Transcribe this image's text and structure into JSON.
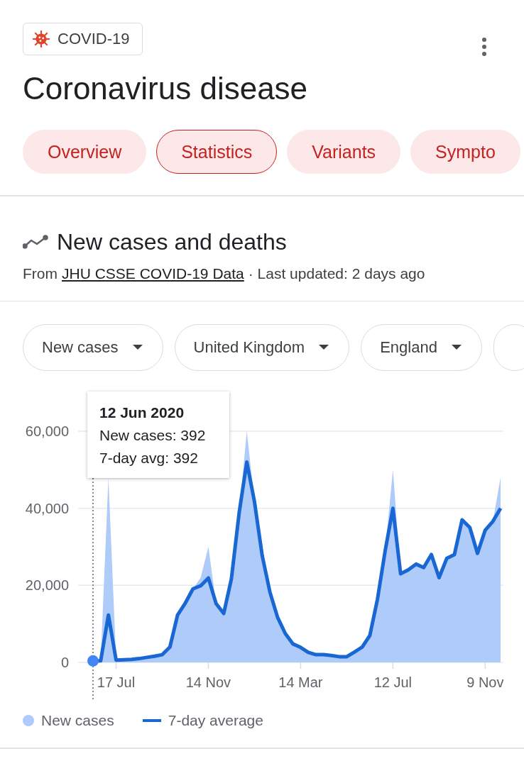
{
  "topic_chip": {
    "label": "COVID-19"
  },
  "title": "Coronavirus disease",
  "tabs": [
    {
      "label": "Overview",
      "selected": false
    },
    {
      "label": "Statistics",
      "selected": true
    },
    {
      "label": "Variants",
      "selected": false
    },
    {
      "label": "Sympto",
      "selected": false
    }
  ],
  "section": {
    "title": "New cases and deaths",
    "source_prefix": "From",
    "source_link": "JHU CSSE COVID-19 Data",
    "updated": "· Last updated: 2 days ago"
  },
  "filters": [
    {
      "label": "New cases"
    },
    {
      "label": "United Kingdom"
    },
    {
      "label": "England"
    }
  ],
  "chart": {
    "tooltip": {
      "date": "12 Jun 2020",
      "lines": [
        "New cases: 392",
        "7-day avg: 392"
      ]
    },
    "chart_data": {
      "type": "area",
      "categories": [
        null,
        null,
        null,
        "17 Jul",
        null,
        null,
        null,
        null,
        null,
        null,
        null,
        null,
        null,
        null,
        null,
        "14 Nov",
        null,
        null,
        null,
        null,
        null,
        null,
        null,
        null,
        null,
        null,
        null,
        "14 Mar",
        null,
        null,
        null,
        null,
        null,
        null,
        null,
        null,
        null,
        null,
        null,
        "12 Jul",
        null,
        null,
        null,
        null,
        null,
        null,
        null,
        null,
        null,
        null,
        null,
        "9 Nov",
        null,
        null
      ],
      "series": [
        {
          "name": "New cases",
          "type": "area",
          "color": "#aecbfa",
          "values": [
            400,
            400,
            48000,
            600,
            700,
            800,
            1000,
            1300,
            1600,
            2000,
            4000,
            12300,
            15400,
            19100,
            22000,
            30000,
            15300,
            12700,
            21700,
            38800,
            60000,
            41700,
            27700,
            18300,
            11700,
            7500,
            4800,
            3900,
            2600,
            2000,
            2000,
            1800,
            1500,
            1500,
            2700,
            4000,
            7000,
            16500,
            29000,
            50000,
            23000,
            24000,
            25500,
            24600,
            28000,
            22000,
            27000,
            28000,
            37000,
            35000,
            28300,
            34300,
            36600,
            48000
          ]
        },
        {
          "name": "7-day average",
          "type": "line",
          "color": "#1967d2",
          "values": [
            400,
            400,
            12300,
            600,
            700,
            800,
            1000,
            1300,
            1600,
            2000,
            4000,
            12300,
            15400,
            19100,
            19900,
            21900,
            15300,
            12700,
            21700,
            38800,
            52000,
            41700,
            27700,
            18300,
            11700,
            7500,
            4800,
            3900,
            2600,
            2000,
            2000,
            1800,
            1500,
            1500,
            2700,
            4000,
            7000,
            16500,
            29000,
            40000,
            23000,
            24000,
            25500,
            24600,
            28000,
            22000,
            27000,
            28000,
            37000,
            35000,
            28300,
            34300,
            36600,
            40000
          ]
        }
      ],
      "ylim": [
        0,
        60000
      ],
      "yticks": [
        {
          "value": 0,
          "label": "0"
        },
        {
          "value": 20000,
          "label": "20,000"
        },
        {
          "value": 40000,
          "label": "40,000"
        },
        {
          "value": 60000,
          "label": "60,000"
        }
      ]
    }
  }
}
